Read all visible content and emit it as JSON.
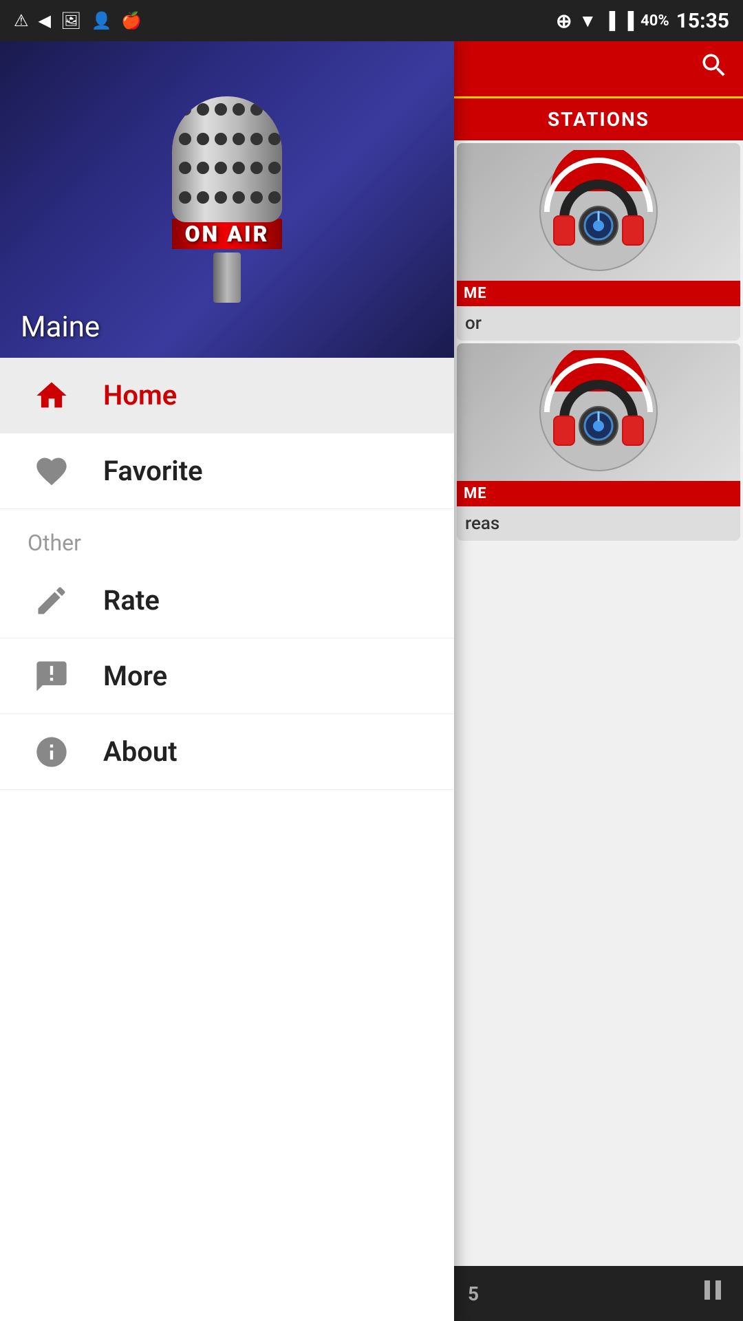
{
  "statusBar": {
    "time": "15:35",
    "battery": "40%",
    "icons": [
      "alert",
      "back",
      "image",
      "user",
      "apple",
      "add",
      "wifi",
      "signal",
      "signal2",
      "battery"
    ]
  },
  "hero": {
    "text": "ON AIR",
    "location": "Maine"
  },
  "menu": {
    "home_label": "Home",
    "favorite_label": "Favorite",
    "other_section": "Other",
    "rate_label": "Rate",
    "more_label": "More",
    "about_label": "About"
  },
  "rightPanel": {
    "stations_label": "STATIONS",
    "station1_label": "ME",
    "station1_info": "or",
    "station2_label": "ME",
    "station2_info": "reas",
    "bottom_number": "5"
  }
}
